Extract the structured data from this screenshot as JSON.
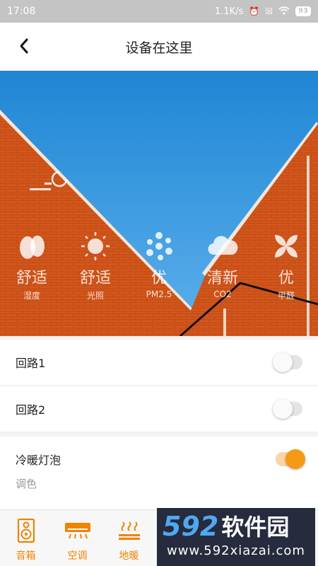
{
  "status_bar": {
    "time": "17:08",
    "speed": "1.1K/s",
    "battery": "93"
  },
  "header": {
    "title": "设备在这里"
  },
  "metrics": [
    {
      "icon": "egg-icon",
      "value": "舒适",
      "label": "湿度"
    },
    {
      "icon": "sun-icon",
      "value": "舒适",
      "label": "光照"
    },
    {
      "icon": "particles-icon",
      "value": "优",
      "label": "PM2.5"
    },
    {
      "icon": "cloud-icon",
      "value": "清新",
      "label": "CO2"
    },
    {
      "icon": "fan-icon",
      "value": "优",
      "label": "甲醛"
    }
  ],
  "rows": [
    {
      "label": "回路1",
      "on": false
    },
    {
      "label": "回路2",
      "on": false
    },
    {
      "label": "冷暖灯泡",
      "on": true
    }
  ],
  "sub_row": {
    "label": "调色"
  },
  "bottom_nav": [
    {
      "icon": "speaker-icon",
      "label": "音箱"
    },
    {
      "icon": "air-conditioner-icon",
      "label": "空调"
    },
    {
      "icon": "floor-heating-icon",
      "label": "地暖"
    }
  ],
  "watermark": {
    "number": "592",
    "brand": "软件园",
    "url": "www.592xiazai.com"
  },
  "colors": {
    "accent": "#f08300",
    "toggle_on": "#f59a16",
    "sky": "#2a8fd6",
    "brick": "#d65a1e"
  }
}
